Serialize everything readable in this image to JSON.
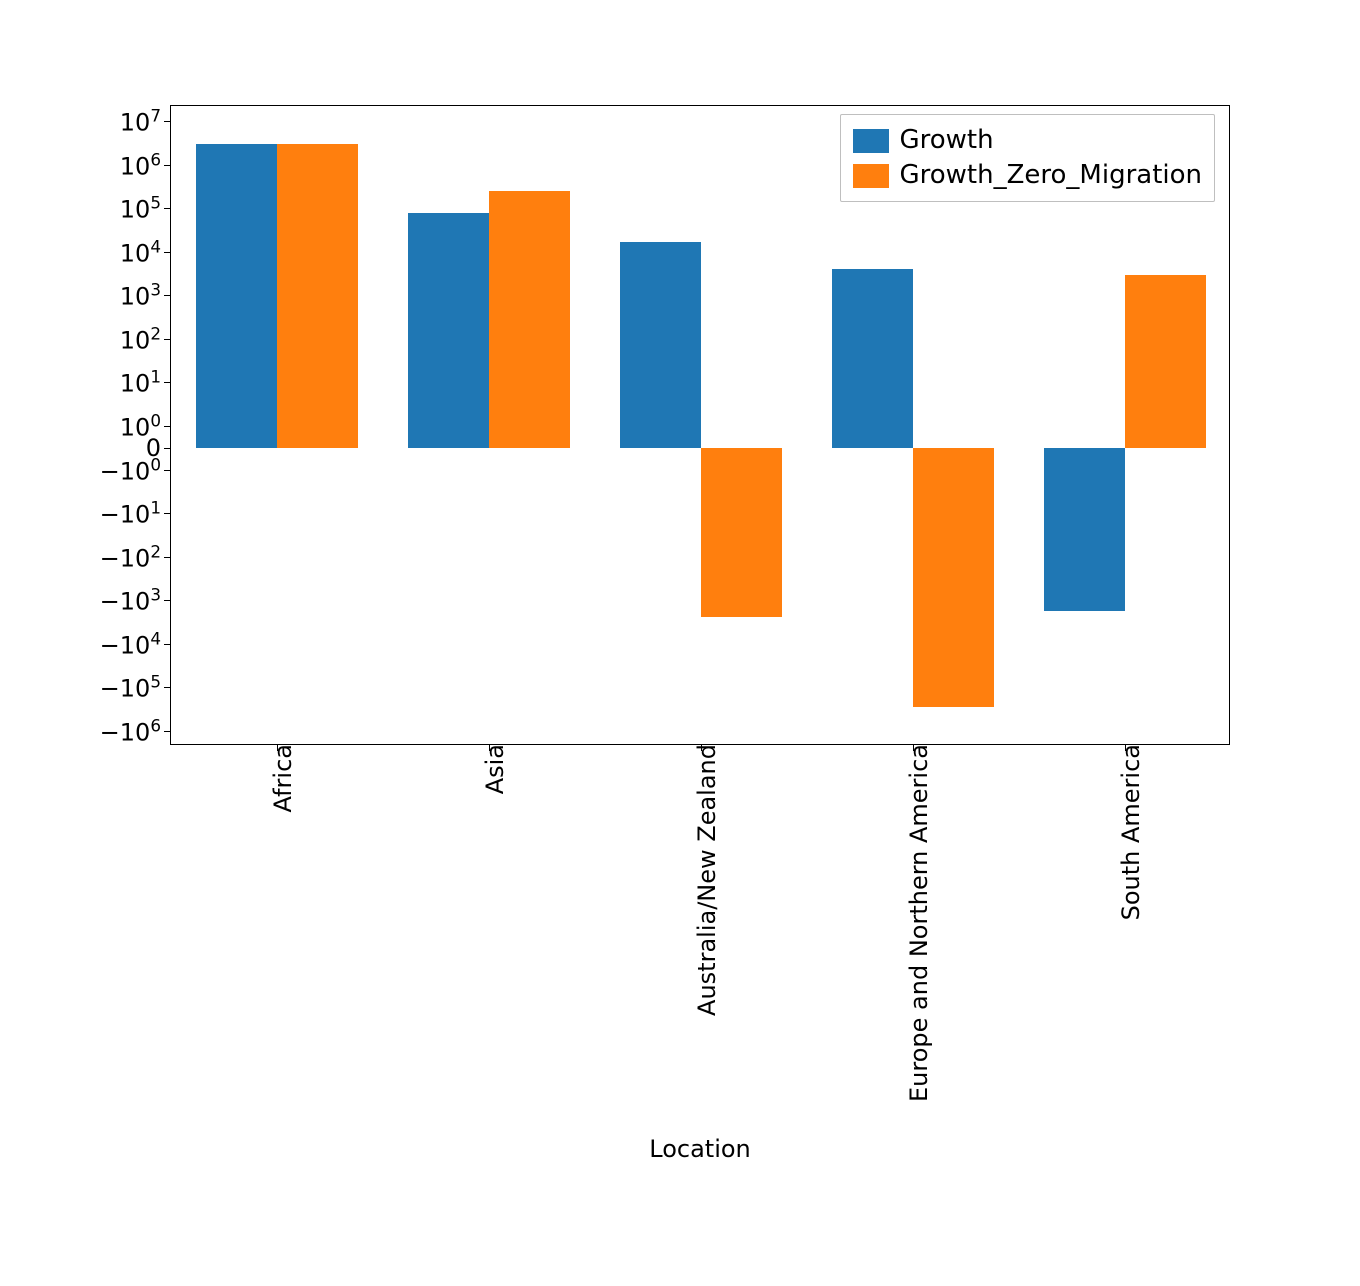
{
  "chart_data": {
    "type": "bar",
    "title": "",
    "xlabel": "Location",
    "ylabel": "",
    "categories": [
      "Africa",
      "Asia",
      "Australia/New Zealand",
      "Europe and Northern America",
      "South America"
    ],
    "series": [
      {
        "name": "Growth",
        "values": [
          3000000,
          80000,
          17000,
          4000,
          -1800
        ]
      },
      {
        "name": "Growth_Zero_Migration",
        "values": [
          3000000,
          250000,
          -2500,
          -280000,
          3000
        ]
      }
    ],
    "y_scale": "symlog",
    "ylim": [
      -1000000,
      10000000
    ],
    "y_ticks_pos": [
      "10^0",
      "10^1",
      "10^2",
      "10^3",
      "10^4",
      "10^5",
      "10^6",
      "10^7"
    ],
    "y_ticks_neg": [
      "-10^0",
      "-10^1",
      "-10^2",
      "-10^3",
      "-10^4",
      "-10^5",
      "-10^6"
    ],
    "zero_label": "0",
    "legend_position": "upper center/right",
    "colors": {
      "Growth": "#1f77b4",
      "Growth_Zero_Migration": "#ff7f0e"
    }
  },
  "legend": {
    "items": [
      {
        "name": "Growth"
      },
      {
        "name": "Growth_Zero_Migration"
      }
    ]
  },
  "axis": {
    "xlabel": "Location",
    "zero_label": "0",
    "y_pos_exp": [
      "0",
      "1",
      "2",
      "3",
      "4",
      "5",
      "6",
      "7"
    ],
    "y_neg_exp": [
      "0",
      "1",
      "2",
      "3",
      "4",
      "5",
      "6"
    ],
    "categories": [
      "Africa",
      "Asia",
      "Australia/New Zealand",
      "Europe and Northern America",
      "South America"
    ]
  }
}
